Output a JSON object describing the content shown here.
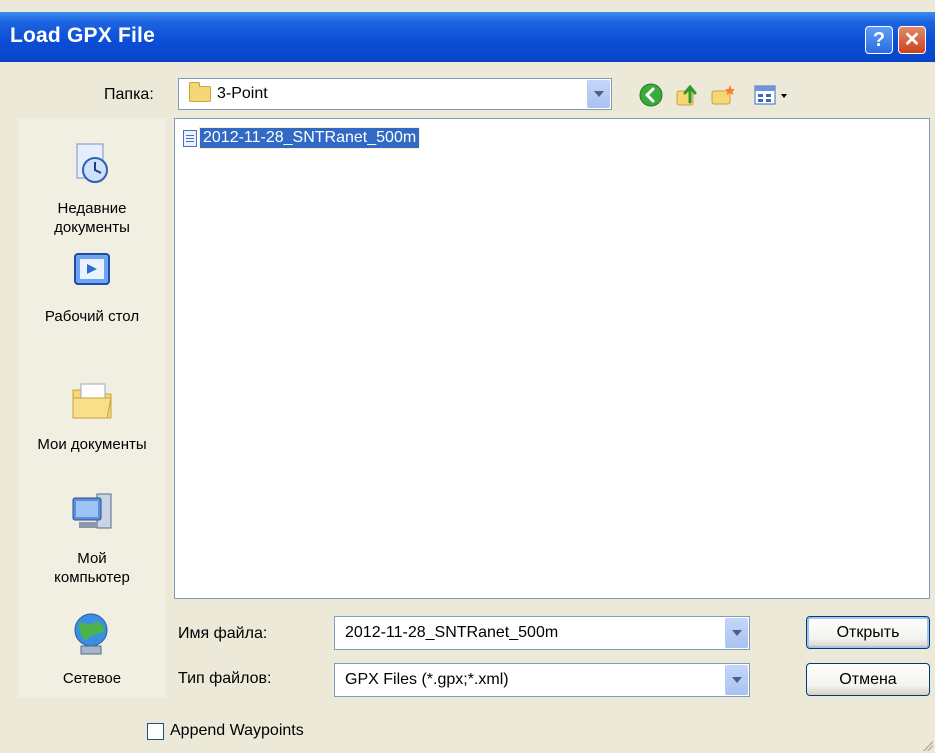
{
  "window": {
    "title": "Load GPX File",
    "help_label": "?",
    "close_label": "✕"
  },
  "lookin": {
    "label": "Папка:",
    "value": "3-Point"
  },
  "places": [
    {
      "label": "Недавние документы",
      "icon": "recent-documents-icon"
    },
    {
      "label": "Рабочий стол",
      "icon": "desktop-icon"
    },
    {
      "label": "Мои документы",
      "icon": "my-documents-icon"
    },
    {
      "label": "Мой компьютер",
      "icon": "my-computer-icon"
    },
    {
      "label": "Сетевое",
      "icon": "network-icon"
    }
  ],
  "files": [
    {
      "name": "2012-11-28_SNTRanet_500m",
      "selected": true
    }
  ],
  "filename": {
    "label": "Имя файла:",
    "value": "2012-11-28_SNTRanet_500m"
  },
  "filetype": {
    "label": "Тип файлов:",
    "value": "GPX Files (*.gpx;*.xml)"
  },
  "buttons": {
    "open": "Открыть",
    "cancel": "Отмена"
  },
  "append_waypoints": {
    "label": "Append Waypoints",
    "checked": false
  }
}
